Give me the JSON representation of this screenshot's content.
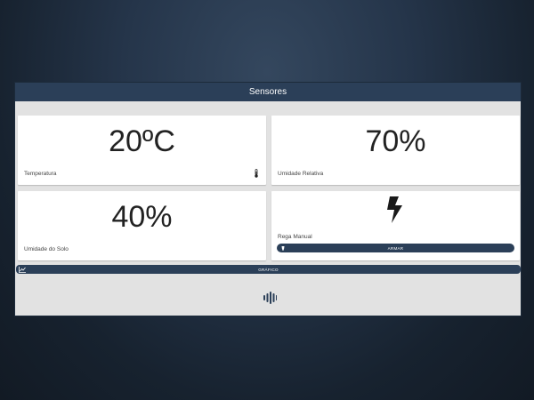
{
  "header": {
    "title": "Sensores"
  },
  "cards": {
    "temperatura": {
      "value": "20ºC",
      "label": "Temperatura",
      "icon": "thermometer-icon"
    },
    "umidade_relativa": {
      "value": "70%",
      "label": "Umidade Relativa"
    },
    "umidade_solo": {
      "value": "40%",
      "label": "Umidade do Solo"
    },
    "rega": {
      "label": "Rega Manual",
      "icon": "lightning-bolt-icon",
      "button_label": "ARMAR"
    }
  },
  "grafico": {
    "label": "GRÁFICO",
    "icon": "chart-line-icon"
  },
  "loader": {
    "icon": "loading-bars-icon"
  },
  "colors": {
    "header_bg": "#2b3f58",
    "panel_bg": "#e2e2e2",
    "card_bg": "#ffffff",
    "text_dark": "#222222"
  }
}
